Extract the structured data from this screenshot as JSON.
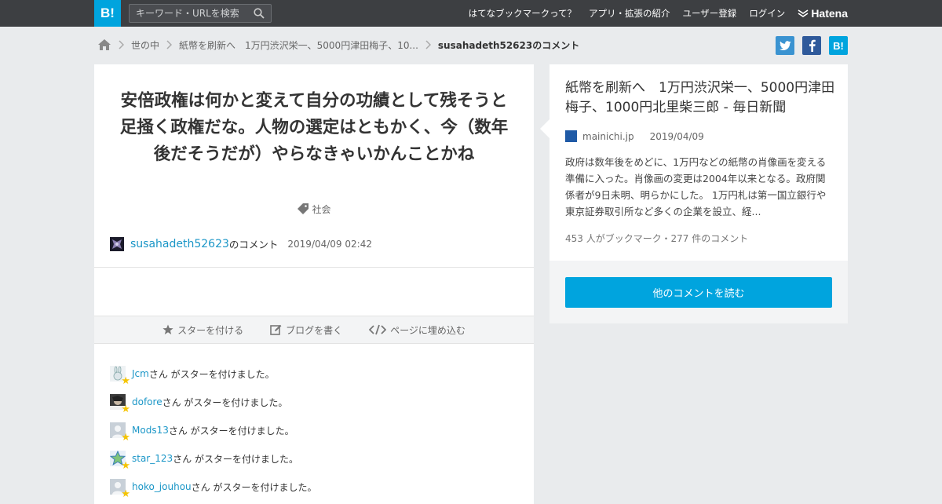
{
  "topbar": {
    "logo": "B!",
    "search_placeholder": "キーワード・URLを検索",
    "nav": [
      "はてなブックマークって？",
      "アプリ・拡張の紹介",
      "ユーザー登録",
      "ログイン"
    ],
    "brand": "Hatena"
  },
  "breadcrumb": {
    "items": [
      "世の中",
      "紙幣を刷新へ　1万円渋沢栄一、5000円津田梅子、10..."
    ],
    "current": "susahadeth52623のコメント"
  },
  "share": {
    "hatena": "B!"
  },
  "comment": {
    "text": "安倍政権は何かと変えて自分の功績として残そうと足掻く政権だな。人物の選定はともかく、今（数年後だそうだが）やらなきゃいかんことかね",
    "tag": "社会",
    "username": "susahadeth52623",
    "suffix": "のコメント",
    "date": "2019/04/09 02:42"
  },
  "actions": {
    "star": "スターを付ける",
    "blog": "ブログを書く",
    "embed": "ページに埋め込む"
  },
  "stars": [
    {
      "user": "Jcm",
      "text": "さん がスターを付けました。"
    },
    {
      "user": "dofore",
      "text": "さん がスターを付けました。"
    },
    {
      "user": "Mods13",
      "text": "さん がスターを付けました。"
    },
    {
      "user": "star_123",
      "text": "さん がスターを付けました。"
    },
    {
      "user": "hoko_jouhou",
      "text": "さん がスターを付けました。"
    }
  ],
  "article": {
    "title": "紙幣を刷新へ　1万円渋沢栄一、5000円津田梅子、1000円北里柴三郎 - 毎日新聞",
    "source": "mainichi.jp",
    "date": "2019/04/09",
    "summary": "政府は数年後をめどに、1万円などの紙幣の肖像画を変える準備に入った。肖像画の変更は2004年以来となる。政府関係者が9日未明、明らかにした。 1万円札は第一国立銀行や東京証券取引所など多くの企業を設立、経...",
    "counts": "453 人がブックマーク・277 件のコメント",
    "read_button": "他のコメントを読む"
  }
}
